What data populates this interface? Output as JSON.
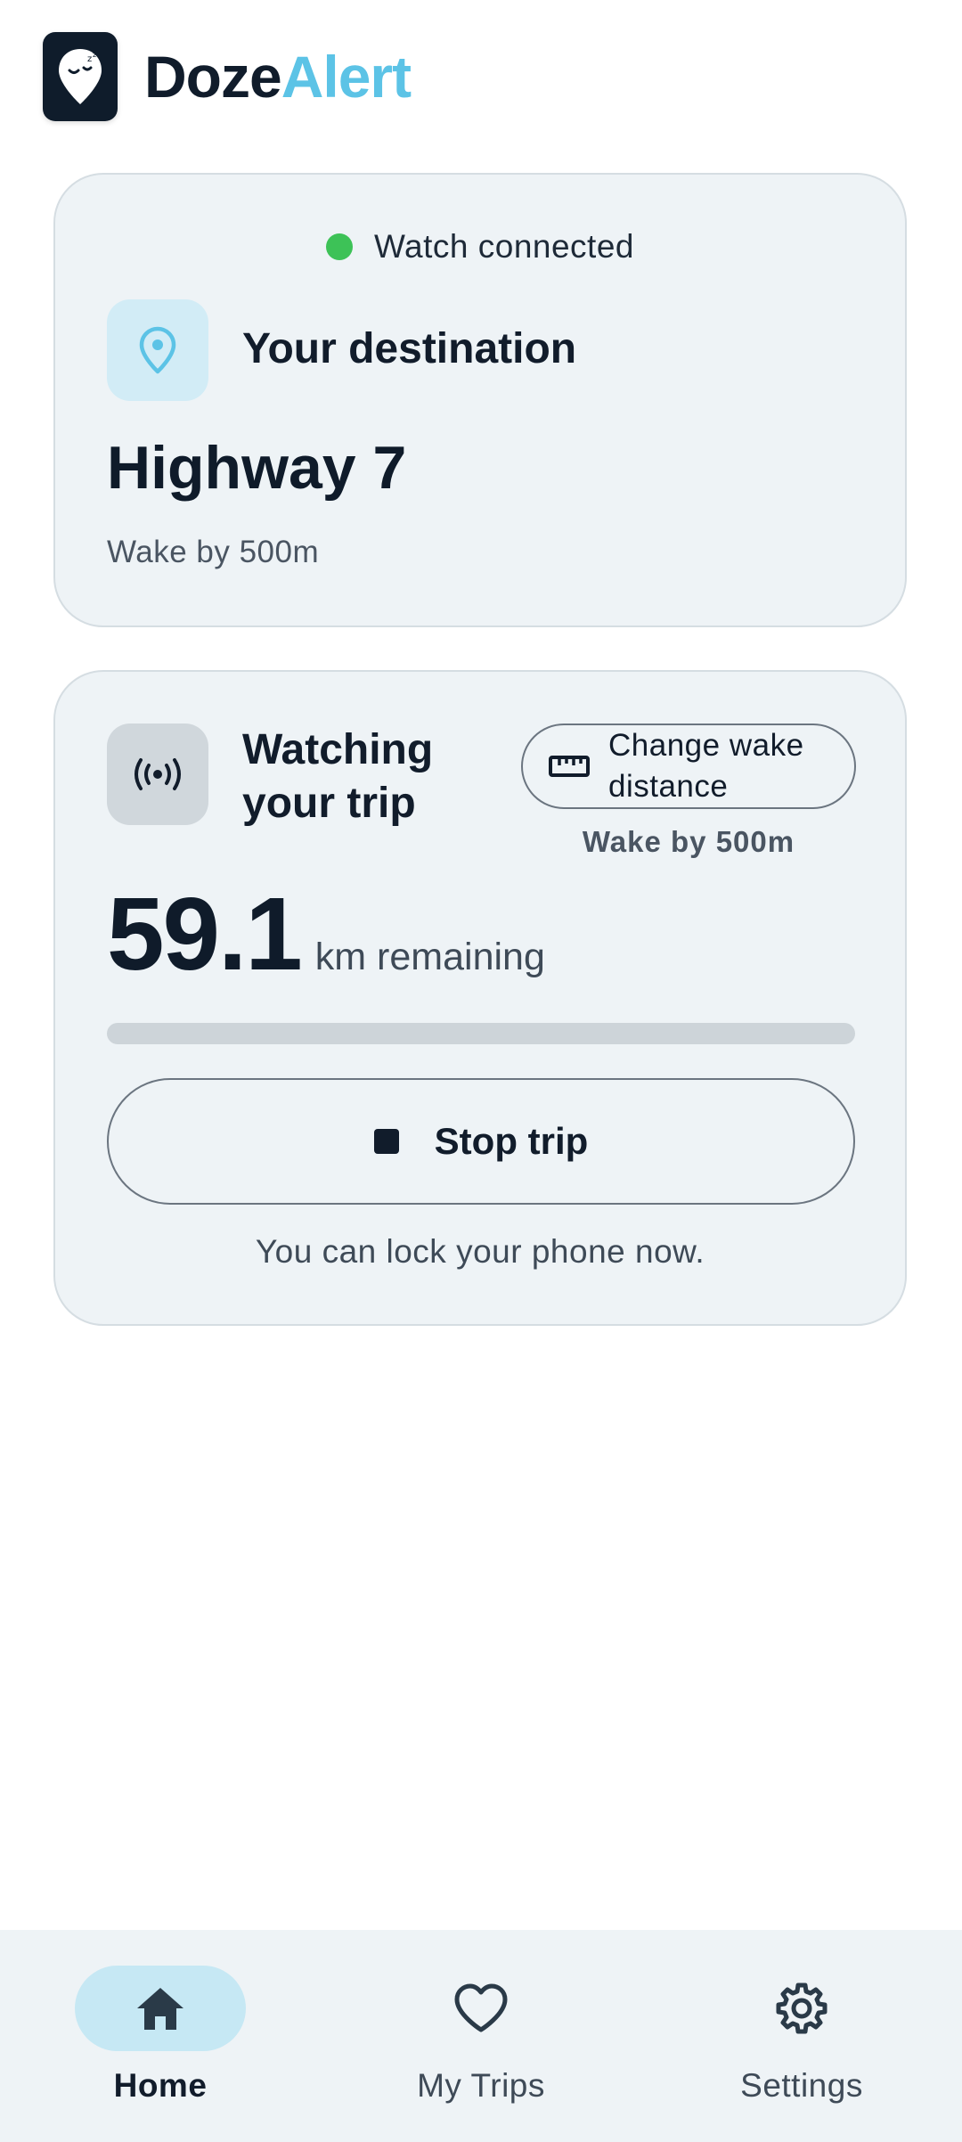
{
  "app": {
    "brand_part1": "Doze",
    "brand_part2": "Alert",
    "logo_icon": "sleepy-location-pin-icon"
  },
  "colors": {
    "accent": "#5cc3e6",
    "dark": "#101c2b",
    "connected": "#3dc257",
    "card_bg": "#eef3f6"
  },
  "destination_card": {
    "status_text": "Watch connected",
    "status_icon": "green-dot",
    "title": "Your destination",
    "title_icon": "location-pin-icon",
    "place": "Highway 7",
    "wake_text": "Wake by 500m"
  },
  "trip_card": {
    "title": "Watching your trip",
    "title_icon": "broadcast-icon",
    "change_button_label": "Change wake distance",
    "change_button_icon": "ruler-icon",
    "wake_text": "Wake by 500m",
    "distance_value": "59.1",
    "distance_unit": "km remaining",
    "progress": 0,
    "stop_button_label": "Stop trip",
    "stop_button_icon": "stop-square-icon",
    "lock_note": "You can lock your phone now."
  },
  "nav": {
    "items": [
      {
        "label": "Home",
        "icon": "home-icon",
        "active": true
      },
      {
        "label": "My Trips",
        "icon": "heart-icon",
        "active": false
      },
      {
        "label": "Settings",
        "icon": "gear-icon",
        "active": false
      }
    ]
  }
}
